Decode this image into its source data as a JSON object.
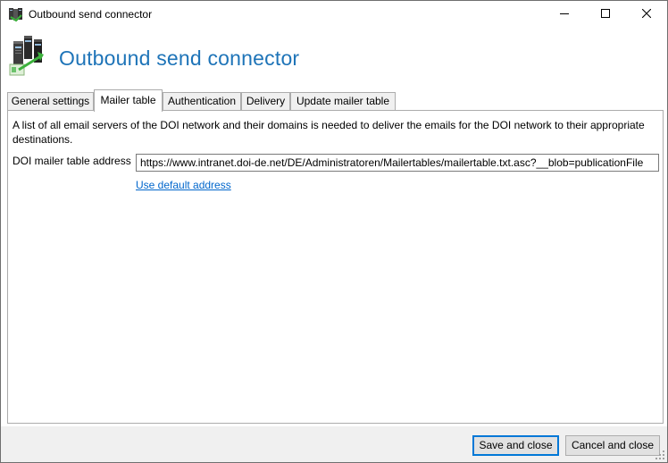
{
  "window": {
    "title": "Outbound send connector",
    "icon": "server-connector-icon",
    "controls": {
      "minimize": "minimize-icon",
      "maximize": "maximize-icon",
      "close": "close-icon"
    }
  },
  "header": {
    "title": "Outbound send connector",
    "icon": "servers-icon"
  },
  "tabs": [
    {
      "label": "General settings",
      "active": false
    },
    {
      "label": "Mailer table",
      "active": true
    },
    {
      "label": "Authentication",
      "active": false
    },
    {
      "label": "Delivery",
      "active": false
    },
    {
      "label": "Update mailer table",
      "active": false
    }
  ],
  "mailer_table": {
    "description": "A list of all email servers of the DOI network and their domains is needed to deliver the emails for the DOI network to their appropriate destinations.",
    "address_label": "DOI mailer table address",
    "address_value": "https://www.intranet.doi-de.net/DE/Administratoren/Mailertables/mailertable.txt.asc?__blob=publicationFile",
    "default_link": "Use default address"
  },
  "footer": {
    "save_label": "Save and close",
    "cancel_label": "Cancel and close"
  },
  "colors": {
    "header_title": "#1e74b8",
    "link": "#0066cc",
    "focus_border": "#0078d7",
    "footer_bg": "#f0f0f0"
  }
}
